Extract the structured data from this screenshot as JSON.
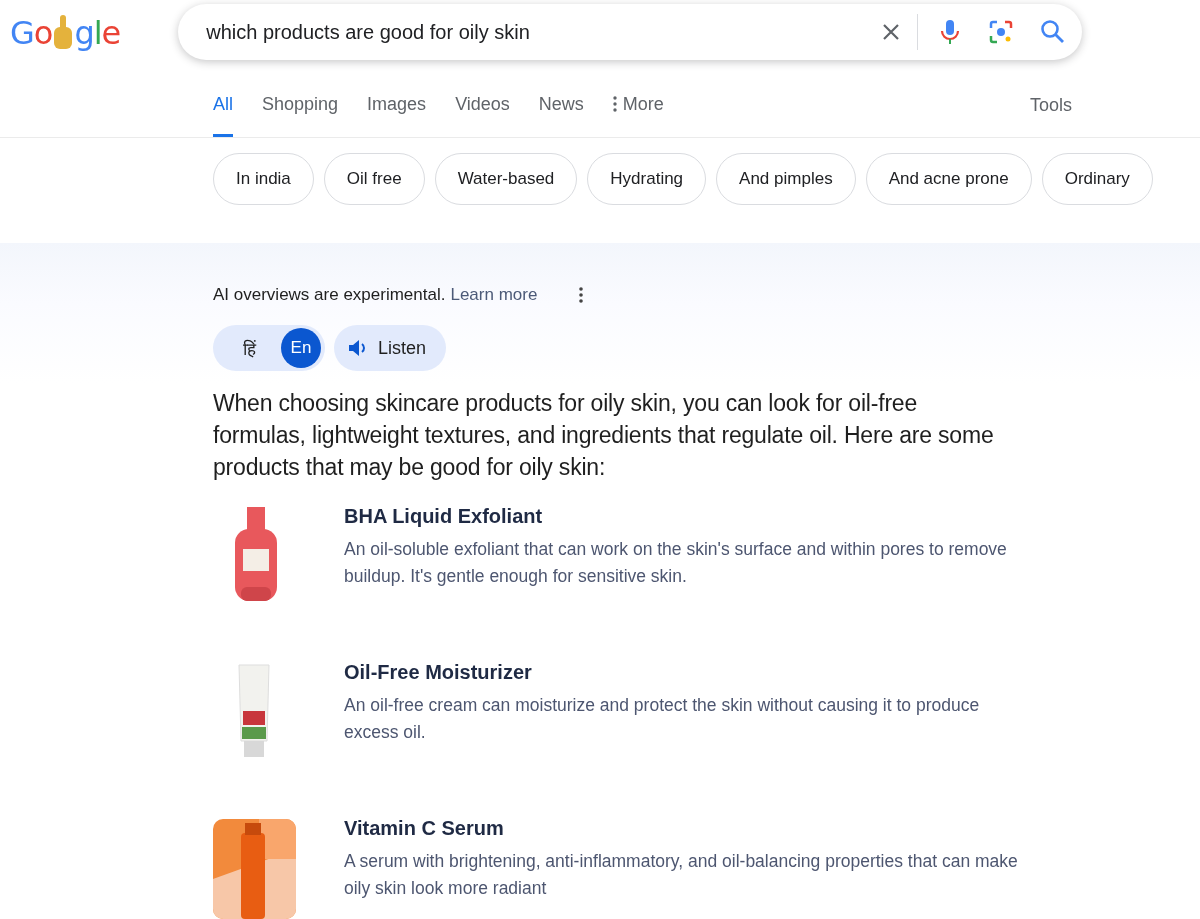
{
  "logo": {
    "start": "Go",
    "end": "gle"
  },
  "search": {
    "value": "which products are good for oily skin"
  },
  "tabs": [
    {
      "label": "All",
      "selected": true
    },
    {
      "label": "Shopping",
      "selected": false
    },
    {
      "label": "Images",
      "selected": false
    },
    {
      "label": "Videos",
      "selected": false
    },
    {
      "label": "News",
      "selected": false
    },
    {
      "label": "More",
      "selected": false,
      "kind": "menu"
    }
  ],
  "tools": "Tools",
  "chips": [
    "In india",
    "Oil free",
    "Water-based",
    "Hydrating",
    "And pimples",
    "And acne prone",
    "Ordinary"
  ],
  "ai_overview": {
    "notice": "AI overviews are experimental.",
    "link": "Learn more",
    "languages": [
      {
        "label": "हिं",
        "selected": false
      },
      {
        "label": "En",
        "selected": true
      }
    ],
    "listen": "Listen",
    "intro": "When choosing skincare products for oily skin, you can look for oil-free formulas, lightweight textures, and ingredients that regulate oil. Here are some products that may be good for oily skin:",
    "products": [
      {
        "title": "BHA Liquid Exfoliant",
        "description": "An oil-soluble exfoliant that can work on the skin's surface and within pores to remove buildup. It's gentle enough for sensitive skin."
      },
      {
        "title": "Oil-Free Moisturizer",
        "description": "An oil-free cream can moisturize and protect the skin without causing it to produce excess oil."
      },
      {
        "title": "Vitamin C Serum",
        "description": "A serum with brightening, anti-inflammatory, and oil-balancing properties that can make oily skin look more radiant"
      }
    ]
  }
}
